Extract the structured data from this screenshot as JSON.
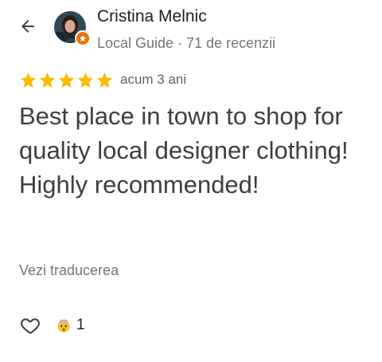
{
  "header": {
    "back_icon": "arrow-back-icon",
    "author": {
      "name": "Cristina Melnic",
      "meta": "Local Guide · 71 de recenzii",
      "badge_icon": "local-guide-star-icon",
      "badge_color": "#e8710a"
    }
  },
  "review": {
    "rating": 5,
    "rating_max": 5,
    "star_color": "#fbbc04",
    "time": "acum 3 ani",
    "text": "Best place in town to shop for quality local designer clothing! Highly recommended!",
    "translate_label": "Vezi traducerea"
  },
  "actions": {
    "like_icon": "heart-outline-icon",
    "reaction_icon": "mind-blown-emoji-icon",
    "reaction_count": "1"
  }
}
